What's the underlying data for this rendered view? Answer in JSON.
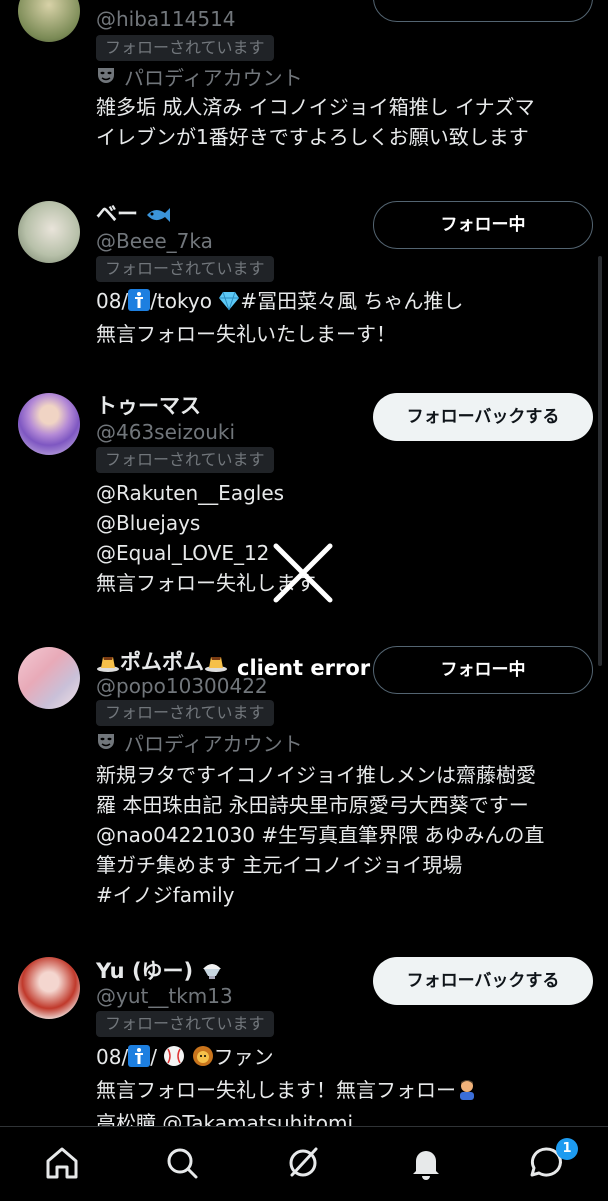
{
  "users": [
    {
      "handle": "@hiba114514",
      "followed_label": "フォローされています",
      "parody_label": "パロディアカウント",
      "bio": [
        "雑多垢 成人済み イコノイジョイ箱推し イナズマ",
        "イレブンが1番好きですよろしくお願い致します"
      ]
    },
    {
      "name": "ベー",
      "handle": "@Beee_7ka",
      "followed_label": "フォローされています",
      "button": "フォロー中",
      "bio_line1_a": "08/",
      "bio_line1_b": "/tokyo ",
      "bio_line1_c": "#冨田菜々風 ちゃん推し",
      "bio_line2": "無言フォロー失礼いたしまーす！"
    },
    {
      "name": "トゥーマス",
      "handle": "@463seizouki",
      "followed_label": "フォローされています",
      "button": "フォローバックする",
      "bio": [
        "@Rakuten__Eagles",
        "@Bluejays",
        "@Equal_LOVE_12",
        "無言フォロー失礼します"
      ]
    },
    {
      "name": "ポムポム",
      "handle": "@popo10300422",
      "followed_label": "フォローされています",
      "button": "フォロー中",
      "parody_label": "パロディアカウント",
      "bio": [
        "新規ヲタですイコノイジョイ推しメンは齋藤樹愛",
        "羅 本田珠由記 永田詩央里市原愛弓大西葵ですー",
        "@nao04221030 #生写真直筆界隈 あゆみんの直",
        "筆ガチ集めます 主元イコノイジョイ現場",
        "#イノジfamily"
      ]
    },
    {
      "name": "Yu (ゆー)",
      "handle": "@yut__tkm13",
      "followed_label": "フォローされています",
      "button": "フォローバックする",
      "bio_line1_a": "08/",
      "bio_line1_b": "/ ",
      "bio_line1_c": "ファン",
      "bio_line2": "無言フォロー失礼します！無言フォロー",
      "bio_line3": "高松瞳 @Takamatsuhitomi"
    }
  ],
  "error_overlay": {
    "text": "client error"
  },
  "tabbar": {
    "icons": [
      "home-icon",
      "search-icon",
      "grok-icon",
      "notifications-icon",
      "messages-icon"
    ],
    "messages_badge": "1"
  },
  "colors": {
    "accent": "#1d9bf0",
    "secondary_text": "#71767b",
    "background": "#000000"
  }
}
